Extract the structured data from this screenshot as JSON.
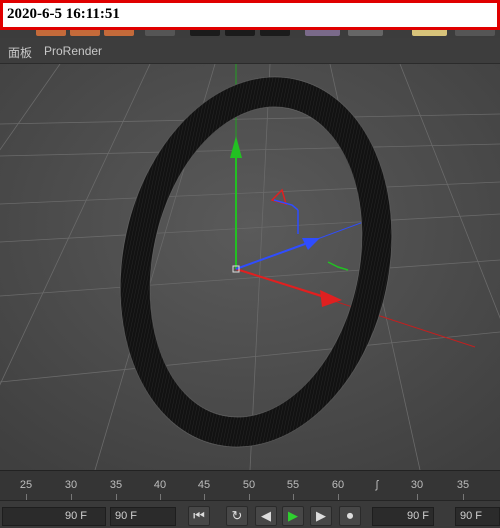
{
  "timestamp": "2020-6-5 16:11:51",
  "menu": {
    "panel": "面板",
    "prorender": "ProRender"
  },
  "timeline": {
    "labels": [
      "25",
      "30",
      "35",
      "40",
      "45",
      "50",
      "55",
      "60",
      "ʃ",
      "30",
      "35"
    ]
  },
  "transport": {
    "start_frame": "90 F",
    "end_frame": "90 F",
    "current_frame_right": "90 F",
    "current_frame_far_right": "90 F",
    "icons": [
      "go-to-start-icon",
      "loop-icon",
      "step-back-icon",
      "play-icon",
      "step-forward-icon",
      "record-icon"
    ]
  },
  "colors": {
    "x_axis": "#e02020",
    "y_axis": "#22c022",
    "z_axis": "#2f4dff",
    "background": "#3a3a3a"
  }
}
